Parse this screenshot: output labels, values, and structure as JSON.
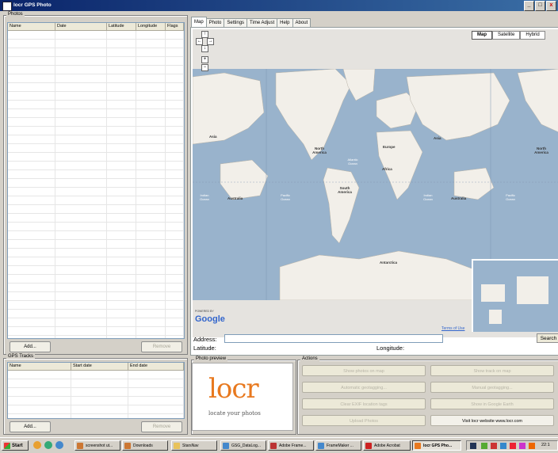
{
  "window": {
    "title": "locr GPS Photo",
    "controls": [
      "_",
      "□",
      "x"
    ]
  },
  "photos": {
    "group_label": "Photos",
    "columns": [
      "Name",
      "Date",
      "Latitude",
      "Longitude",
      "Flags"
    ],
    "add_label": "Add...",
    "remove_label": "Remove"
  },
  "tracks": {
    "group_label": "GPS Tracks",
    "columns": [
      "Name",
      "Start date",
      "End date"
    ],
    "add_label": "Add...",
    "remove_label": "Remove"
  },
  "tabs": [
    "Map",
    "Photo",
    "Settings",
    "Time Adjust",
    "Help",
    "About"
  ],
  "map": {
    "types": [
      "Map",
      "Satellite",
      "Hybrid"
    ],
    "active_type": "Map",
    "powered_by": "POWERED BY",
    "logo": "Google",
    "terms": "Terms of Use",
    "labels": {
      "asia_left": "Asia",
      "australia_left": "Australia",
      "north_america": "North America",
      "europe": "Europe",
      "africa": "Africa",
      "asia": "Asia",
      "south_america": "South America",
      "australia": "Australia",
      "antarctica": "Antarctica",
      "north_america_right": "North America",
      "atlantic": "Atlantic Ocean",
      "indian_left": "Indian Ocean",
      "pacific_left": "Pacific Ocean",
      "indian": "Indian Ocean",
      "pacific_right": "Pacific Ocean"
    }
  },
  "address": {
    "label": "Address:",
    "value": "",
    "search_label": "Search",
    "latitude_label": "Latitude:",
    "longitude_label": "Longitude:"
  },
  "preview": {
    "group_label": "Photo preview",
    "logo_text": "locr",
    "tagline": "locate your photos"
  },
  "actions": {
    "group_label": "Actions",
    "buttons": [
      {
        "label": "Show photos on map",
        "enabled": false
      },
      {
        "label": "Show track on map",
        "enabled": false
      },
      {
        "label": "Automatic geotagging...",
        "enabled": false
      },
      {
        "label": "Manual geotagging...",
        "enabled": false
      },
      {
        "label": "Clear EXIF location tags",
        "enabled": false
      },
      {
        "label": "Show in Google Earth",
        "enabled": false
      },
      {
        "label": "Upload Photos",
        "enabled": false
      },
      {
        "label": "Visit locr website www.locr.com",
        "enabled": true
      }
    ]
  },
  "taskbar": {
    "start_label": "Start",
    "items": [
      "screenshot ut...",
      "Downloads",
      "StarsNav",
      "GSG_DataLog...",
      "Adobe Frame...",
      "FrameMaker ...",
      "Adobe Acrobat",
      "locr GPS Pho..."
    ],
    "active": "locr GPS Pho...",
    "clock": "22:1"
  }
}
